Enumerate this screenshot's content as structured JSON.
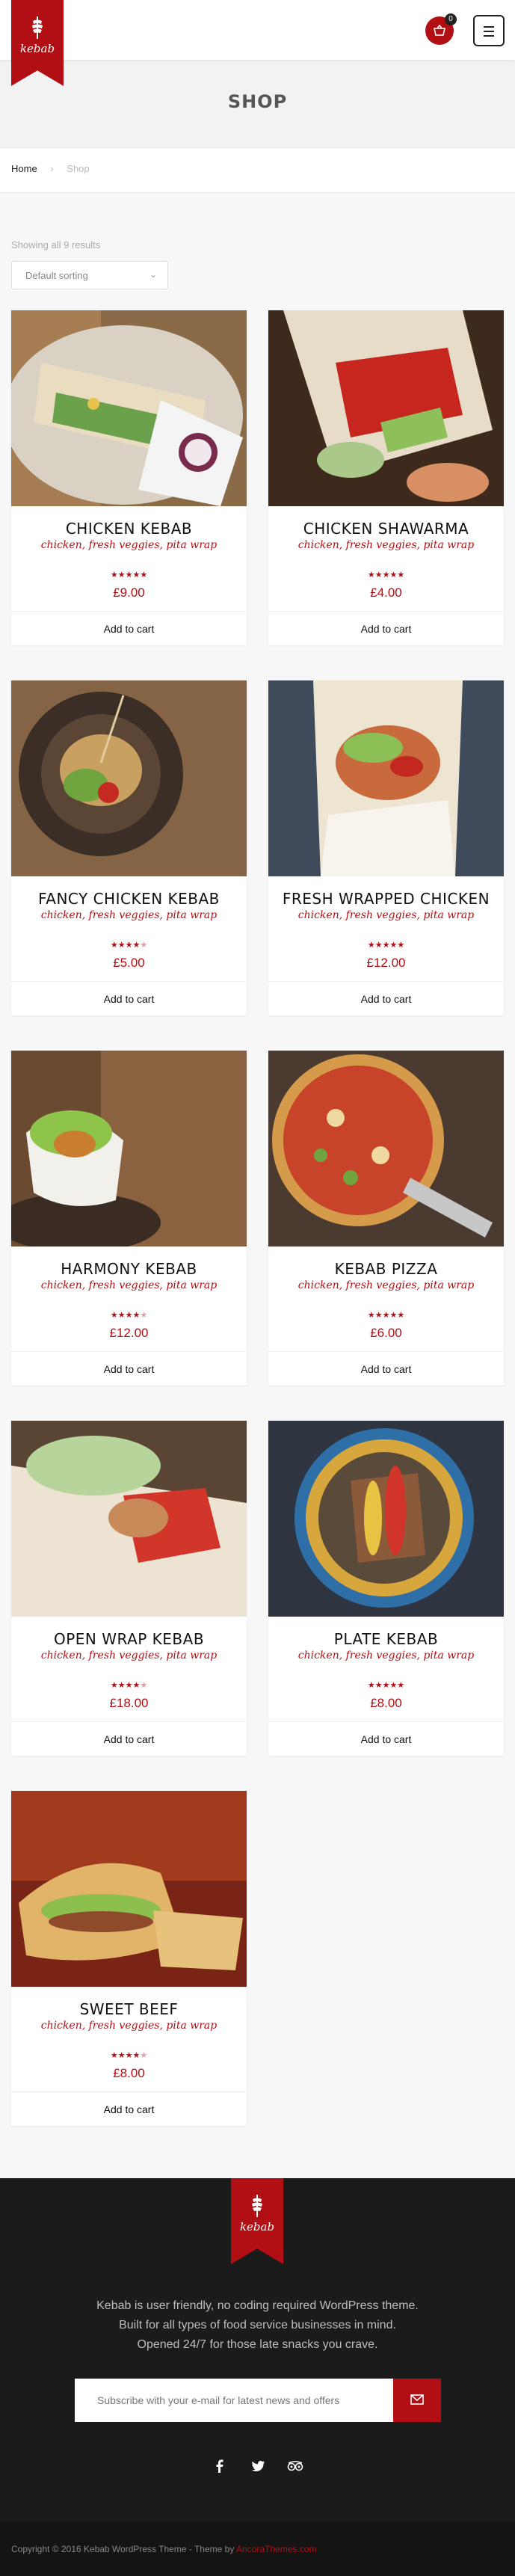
{
  "header": {
    "logo_text": "kebab",
    "cart_count": "0"
  },
  "page": {
    "title": "SHOP"
  },
  "breadcrumb": {
    "home": "Home",
    "separator": "›",
    "current": "Shop"
  },
  "shop": {
    "result_count": "Showing all 9 results",
    "sorting": {
      "selected": "Default sorting"
    }
  },
  "products": [
    {
      "name": "CHICKEN KEBAB",
      "desc": "chicken, fresh veggies, pita wrap",
      "price": "£9.00",
      "rating": 5,
      "button": "Add to cart"
    },
    {
      "name": "CHICKEN SHAWARMA",
      "desc": "chicken, fresh veggies, pita wrap",
      "price": "£4.00",
      "rating": 5,
      "button": "Add to cart"
    },
    {
      "name": "FANCY CHICKEN KEBAB",
      "desc": "chicken, fresh veggies, pita wrap",
      "price": "£5.00",
      "rating": 4,
      "button": "Add to cart"
    },
    {
      "name": "FRESH WRAPPED CHICKEN",
      "desc": "chicken, fresh veggies, pita wrap",
      "price": "£12.00",
      "rating": 5,
      "button": "Add to cart"
    },
    {
      "name": "HARMONY KEBAB",
      "desc": "chicken, fresh veggies, pita wrap",
      "price": "£12.00",
      "rating": 4,
      "button": "Add to cart"
    },
    {
      "name": "KEBAB PIZZA",
      "desc": "chicken, fresh veggies, pita wrap",
      "price": "£6.00",
      "rating": 5,
      "button": "Add to cart"
    },
    {
      "name": "OPEN WRAP KEBAB",
      "desc": "chicken, fresh veggies, pita wrap",
      "price": "£18.00",
      "rating": 4,
      "button": "Add to cart"
    },
    {
      "name": "PLATE KEBAB",
      "desc": "chicken, fresh veggies, pita wrap",
      "price": "£8.00",
      "rating": 5,
      "button": "Add to cart"
    },
    {
      "name": "SWEET BEEF",
      "desc": "chicken, fresh veggies, pita wrap",
      "price": "£8.00",
      "rating": 4,
      "button": "Add to cart"
    }
  ],
  "footer": {
    "logo_text": "kebab",
    "text_line1": "Kebab is user friendly, no coding required WordPress theme.",
    "text_line2": "Built for all types of food service businesses in mind.",
    "text_line3": "Opened 24/7 for those late snacks you crave.",
    "subscribe_placeholder": "Subscribe with your e-mail for latest news and offers",
    "socials": [
      "facebook-icon",
      "twitter-icon",
      "tripadvisor-icon"
    ],
    "copyright": "Copyright © 2016 Kebab WordPress Theme - Theme by",
    "author": "AncoraThemes.com"
  },
  "colors": {
    "brand": "#b10f14",
    "footer_bg": "#1b1b1c"
  }
}
